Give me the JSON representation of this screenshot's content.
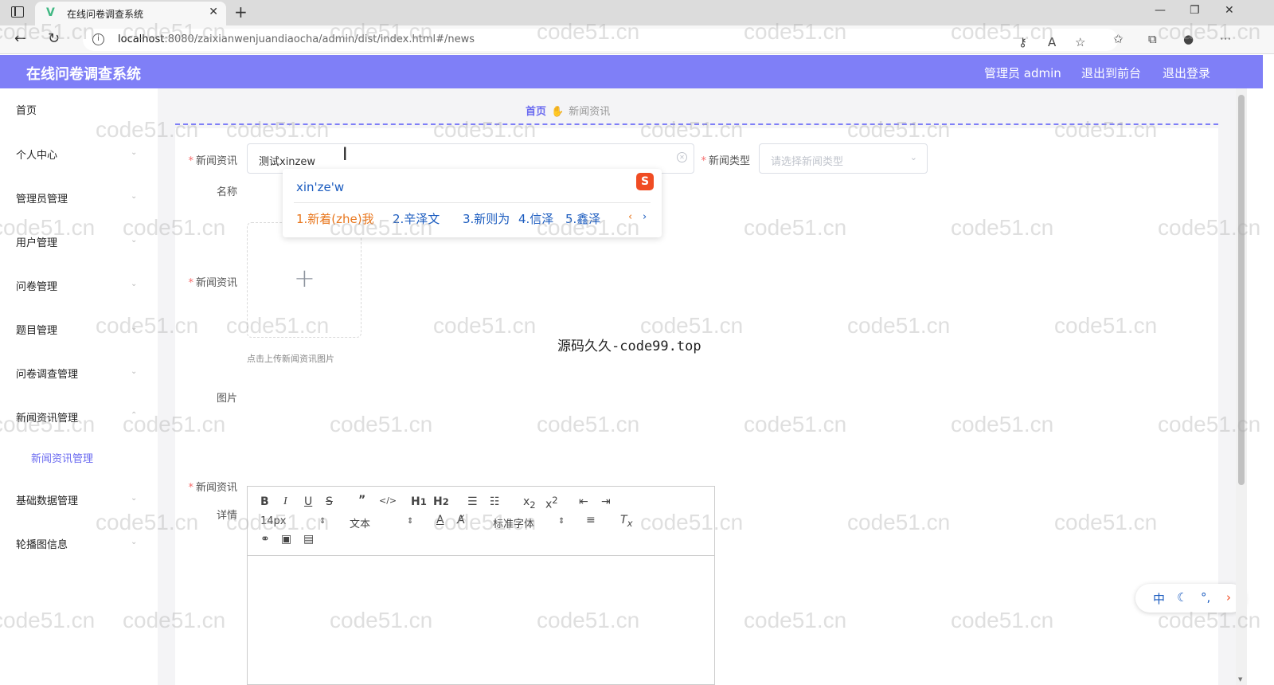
{
  "browser": {
    "tab_title": "在线问卷调查系统",
    "url_host": "localhost",
    "url_rest": ":8080/zaixianwenjuandiaocha/admin/dist/index.html#/news"
  },
  "header": {
    "title": "在线问卷调查系统",
    "admin_label": "管理员 admin",
    "front_link": "退出到前台",
    "logout_link": "退出登录"
  },
  "sidebar": {
    "items": [
      {
        "label": "首页"
      },
      {
        "label": "个人中心"
      },
      {
        "label": "管理员管理"
      },
      {
        "label": "用户管理"
      },
      {
        "label": "问卷管理"
      },
      {
        "label": "题目管理"
      },
      {
        "label": "问卷调查管理"
      },
      {
        "label": "新闻资讯管理"
      },
      {
        "label": "新闻资讯管理"
      },
      {
        "label": "基础数据管理"
      },
      {
        "label": "轮播图信息"
      }
    ]
  },
  "breadcrumb": {
    "home": "首页",
    "current": "新闻资讯"
  },
  "form": {
    "name_label_1": "新闻资讯",
    "name_label_2": "名称",
    "name_value": "测试xinzew",
    "type_label": "新闻类型",
    "type_placeholder": "请选择新闻类型",
    "image_label_1": "新闻资讯",
    "image_label_2": "图片",
    "upload_tip": "点击上传新闻资讯图片",
    "detail_label_1": "新闻资讯",
    "detail_label_2": "详情"
  },
  "ime": {
    "pinyin": "xin'ze'w",
    "candidates": [
      "1.新着(zhe)我",
      "2.辛泽文",
      "3.新则为",
      "4.信泽",
      "5.鑫泽"
    ],
    "logo": "S"
  },
  "editor": {
    "font_size": "14px",
    "paragraph": "文本",
    "font_family": "标准字体"
  },
  "ime_float": {
    "lang": "中"
  },
  "watermarks": {
    "center_text": "源码久久-code99.top",
    "text": "code51.cn"
  }
}
